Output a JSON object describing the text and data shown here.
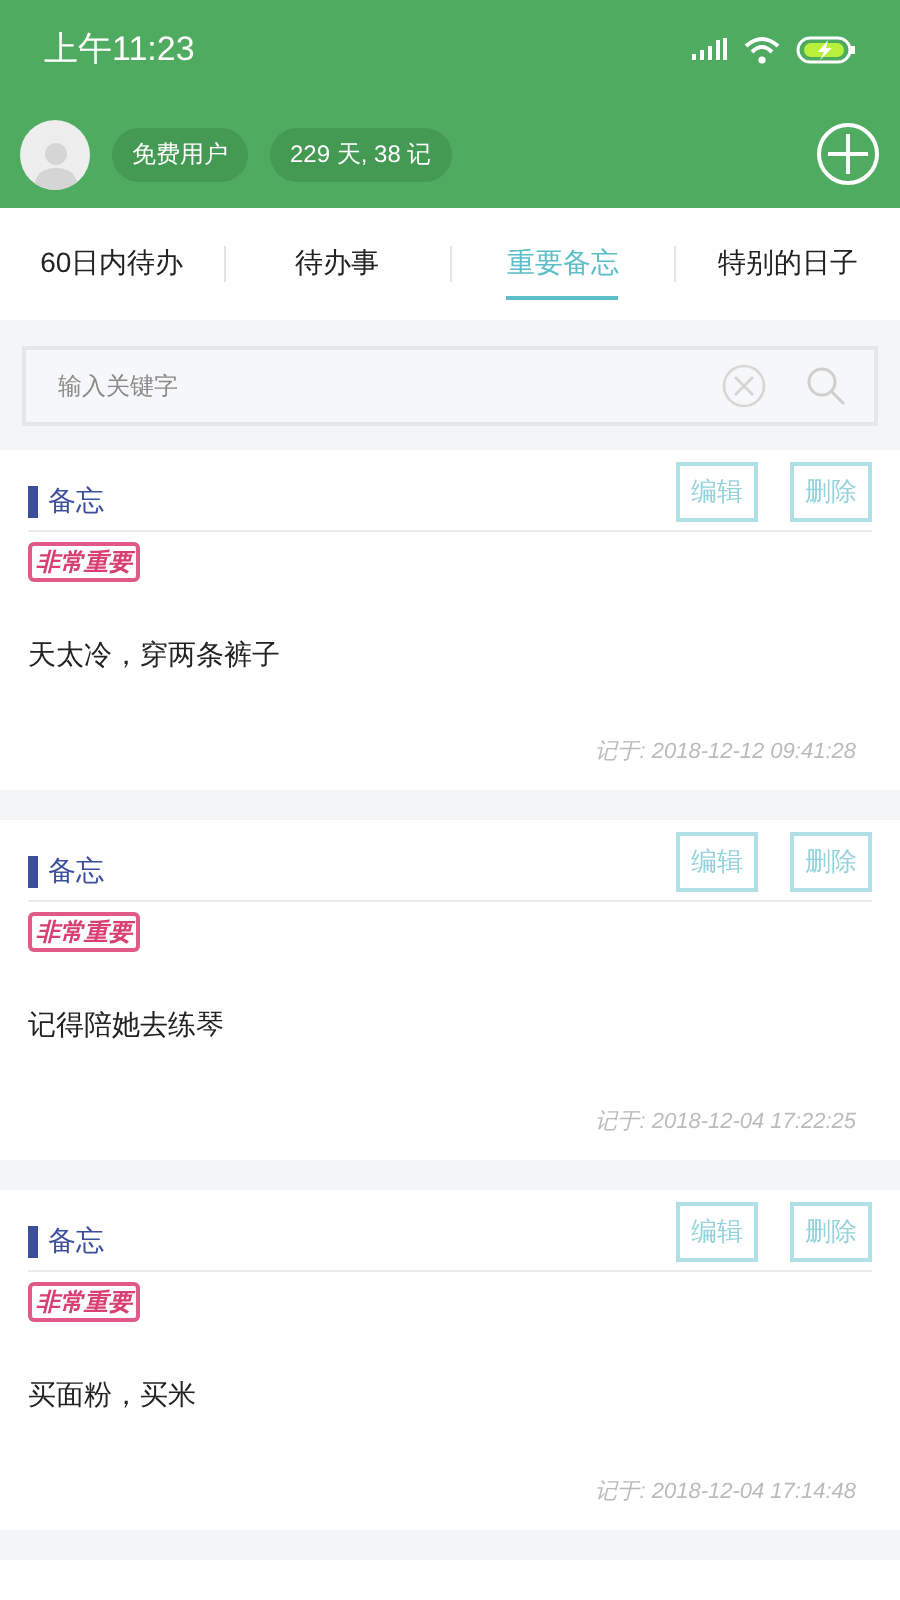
{
  "status_bar": {
    "time": "上午11:23"
  },
  "header": {
    "badges": [
      "免费用户",
      "229 天, 38 记"
    ]
  },
  "tabs": [
    {
      "label": "60日内待办",
      "selected": false
    },
    {
      "label": "待办事",
      "selected": false
    },
    {
      "label": "重要备忘",
      "selected": true
    },
    {
      "label": "特别的日子",
      "selected": false
    }
  ],
  "search": {
    "placeholder": "输入关键字"
  },
  "notes": [
    {
      "category": "备忘",
      "tag": "非常重要",
      "text": "天太冷，穿两条裤子",
      "date": "记于: 2018-12-12 09:41:28",
      "actions": [
        "编辑",
        "删除"
      ]
    },
    {
      "category": "备忘",
      "tag": "非常重要",
      "text": "记得陪她去练琴",
      "date": "记于: 2018-12-04 17:22:25",
      "actions": [
        "编辑",
        "删除"
      ]
    },
    {
      "category": "备忘",
      "tag": "非常重要",
      "text": "买面粉，买米",
      "date": "记于: 2018-12-04 17:14:48",
      "actions": [
        "编辑",
        "删除"
      ]
    }
  ]
}
